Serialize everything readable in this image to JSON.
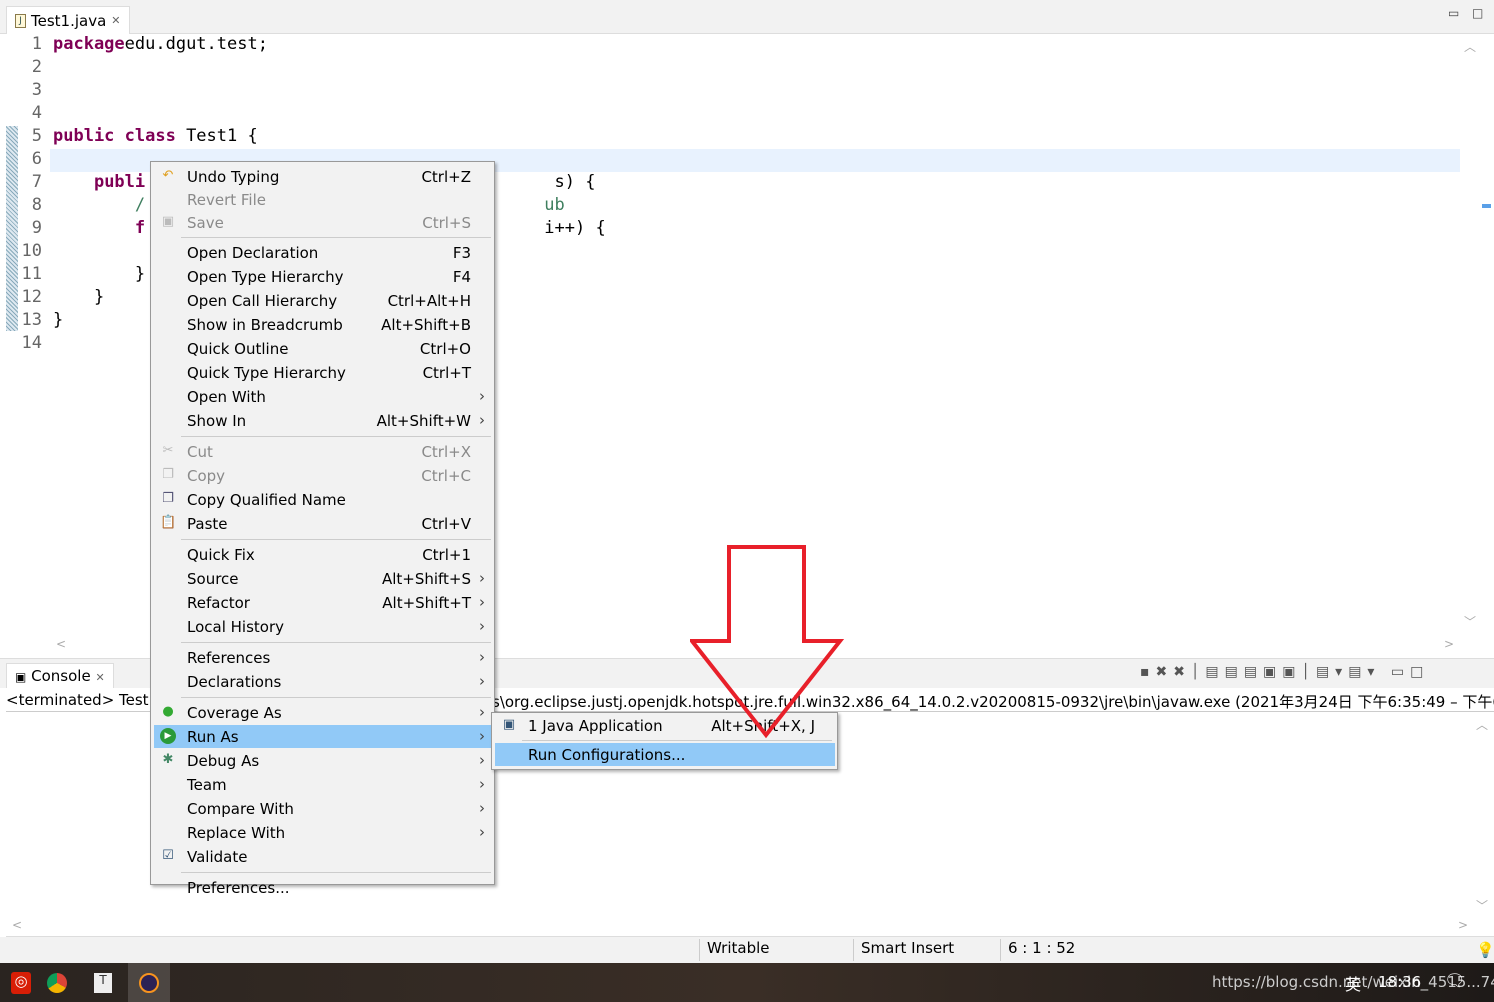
{
  "editor": {
    "tab_label": "Test1.java",
    "lines": [
      {
        "n": "1",
        "parts": [
          [
            "kw",
            "package"
          ],
          [
            "",
            "edu.dgut.test;"
          ]
        ]
      },
      {
        "n": "2",
        "parts": []
      },
      {
        "n": "3",
        "parts": []
      },
      {
        "n": "4",
        "parts": []
      },
      {
        "n": "5",
        "parts": [
          [
            "kw",
            "public class"
          ],
          [
            "",
            " Test1 {"
          ]
        ]
      },
      {
        "n": "6",
        "parts": []
      },
      {
        "n": "7",
        "parts": [
          [
            "",
            "    "
          ],
          [
            "kw",
            "publi"
          ],
          [
            "",
            "                                        s) {"
          ]
        ]
      },
      {
        "n": "8",
        "parts": [
          [
            "",
            "        "
          ],
          [
            "cm",
            "/                                       ub"
          ]
        ]
      },
      {
        "n": "9",
        "parts": [
          [
            "",
            "        "
          ],
          [
            "kw",
            "f"
          ],
          [
            "",
            "                                       i++) {"
          ]
        ]
      },
      {
        "n": "10",
        "parts": []
      },
      {
        "n": "11",
        "parts": [
          [
            "",
            "        }"
          ]
        ]
      },
      {
        "n": "12",
        "parts": [
          [
            "",
            "    }"
          ]
        ]
      },
      {
        "n": "13",
        "parts": [
          [
            "",
            "}"
          ]
        ]
      },
      {
        "n": "14",
        "parts": []
      }
    ]
  },
  "console": {
    "tab_label": "Console",
    "terminated": "<terminated> Test1",
    "path": "s\\org.eclipse.justj.openjdk.hotspot.jre.full.win32.x86_64_14.0.2.v20200815-0932\\jre\\bin\\javaw.exe  (2021年3月24日 下午6:35:49 – 下午6:35"
  },
  "context_menu": {
    "items": [
      {
        "label": "Undo Typing",
        "shortcut": "Ctrl+Z",
        "icon": "undo-icon"
      },
      {
        "label": "Revert File",
        "disabled": true
      },
      {
        "label": "Save",
        "shortcut": "Ctrl+S",
        "disabled": true,
        "icon": "save-icon"
      },
      {
        "sep": true
      },
      {
        "label": "Open Declaration",
        "shortcut": "F3"
      },
      {
        "label": "Open Type Hierarchy",
        "shortcut": "F4"
      },
      {
        "label": "Open Call Hierarchy",
        "shortcut": "Ctrl+Alt+H"
      },
      {
        "label": "Show in Breadcrumb",
        "shortcut": "Alt+Shift+B"
      },
      {
        "label": "Quick Outline",
        "shortcut": "Ctrl+O"
      },
      {
        "label": "Quick Type Hierarchy",
        "shortcut": "Ctrl+T"
      },
      {
        "label": "Open With",
        "submenu": true
      },
      {
        "label": "Show In",
        "shortcut": "Alt+Shift+W",
        "submenu": true
      },
      {
        "sep": true
      },
      {
        "label": "Cut",
        "shortcut": "Ctrl+X",
        "disabled": true,
        "icon": "cut-icon"
      },
      {
        "label": "Copy",
        "shortcut": "Ctrl+C",
        "disabled": true,
        "icon": "copy-icon"
      },
      {
        "label": "Copy Qualified Name",
        "icon": "copy-qualified-icon"
      },
      {
        "label": "Paste",
        "shortcut": "Ctrl+V",
        "icon": "paste-icon"
      },
      {
        "sep": true
      },
      {
        "label": "Quick Fix",
        "shortcut": "Ctrl+1"
      },
      {
        "label": "Source",
        "shortcut": "Alt+Shift+S",
        "submenu": true
      },
      {
        "label": "Refactor",
        "shortcut": "Alt+Shift+T",
        "submenu": true
      },
      {
        "label": "Local History",
        "submenu": true
      },
      {
        "sep": true
      },
      {
        "label": "References",
        "submenu": true
      },
      {
        "label": "Declarations",
        "submenu": true
      },
      {
        "sep": true
      },
      {
        "label": "Coverage As",
        "submenu": true,
        "icon": "coverage-icon"
      },
      {
        "label": "Run As",
        "submenu": true,
        "selected": true,
        "icon": "run-icon"
      },
      {
        "label": "Debug As",
        "submenu": true,
        "icon": "debug-icon"
      },
      {
        "label": "Team",
        "submenu": true
      },
      {
        "label": "Compare With",
        "submenu": true
      },
      {
        "label": "Replace With",
        "submenu": true
      },
      {
        "label": "Validate",
        "icon": "checkbox-icon"
      },
      {
        "sep": true
      },
      {
        "label": "Preferences..."
      }
    ]
  },
  "run_as_submenu": {
    "items": [
      {
        "label": "1 Java Application",
        "shortcut": "Alt+Shift+X, J"
      },
      {
        "label": "Run Configurations...",
        "selected": true
      }
    ]
  },
  "status_bar": {
    "writable": "Writable",
    "insert_mode": "Smart Insert",
    "position": "6 : 1 : 52"
  },
  "taskbar": {
    "watermark": "https://blog.csdn.net/weixin_4515...74",
    "time": "18:36",
    "ime": "英"
  },
  "colors": {
    "keyword": "#7f0055",
    "comment": "#3f7f5f",
    "selection": "#91c9f7",
    "annotation_arrow": "#e8202a"
  }
}
